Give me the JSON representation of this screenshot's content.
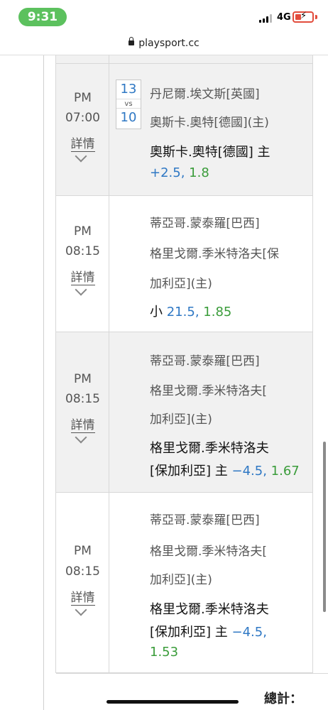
{
  "status": {
    "time": "9:31",
    "network": "4G"
  },
  "browser": {
    "domain": "playsport.cc"
  },
  "rows": [
    {
      "ampm": "PM",
      "time": "07:00",
      "detail": "詳情",
      "score_home": "13",
      "vs": "vs",
      "score_away": "10",
      "team1": "丹尼爾.埃文斯[英國]",
      "team2": "奧斯卡.奧特[德國](主)",
      "pick_line1": "奧斯卡.奧特[德國] 主",
      "pick_odds_a": "+2.5,",
      "pick_odds_b": " 1.8"
    },
    {
      "ampm": "PM",
      "time": "08:15",
      "detail": "詳情",
      "team1": "蒂亞哥.蒙泰羅[巴西]",
      "team2a": "格里戈爾.季米特洛夫[保",
      "team2b": "加利亞](主)",
      "pick_prefix": "小 ",
      "pick_odds_a": "21.5,",
      "pick_odds_b": " 1.85"
    },
    {
      "ampm": "PM",
      "time": "08:15",
      "detail": "詳情",
      "team1": "蒂亞哥.蒙泰羅[巴西]",
      "team2a": "格里戈爾.季米特洛夫[",
      "team2b": "加利亞](主)",
      "pick_line1": "格里戈爾.季米特洛夫",
      "pick_line2": "[保加利亞] 主 ",
      "pick_odds_a": "−4.5,",
      "pick_odds_b": " 1.67"
    },
    {
      "ampm": "PM",
      "time": "08:15",
      "detail": "詳情",
      "team1": "蒂亞哥.蒙泰羅[巴西]",
      "team2a": "格里戈爾.季米特洛夫[",
      "team2b": "加利亞](主)",
      "pick_line1": "格里戈爾.季米特洛夫",
      "pick_line2": "[保加利亞] 主 ",
      "pick_odds_a": "−4.5,",
      "pick_odds_b": "1.53"
    }
  ],
  "footer": {
    "total_label": "總計："
  }
}
